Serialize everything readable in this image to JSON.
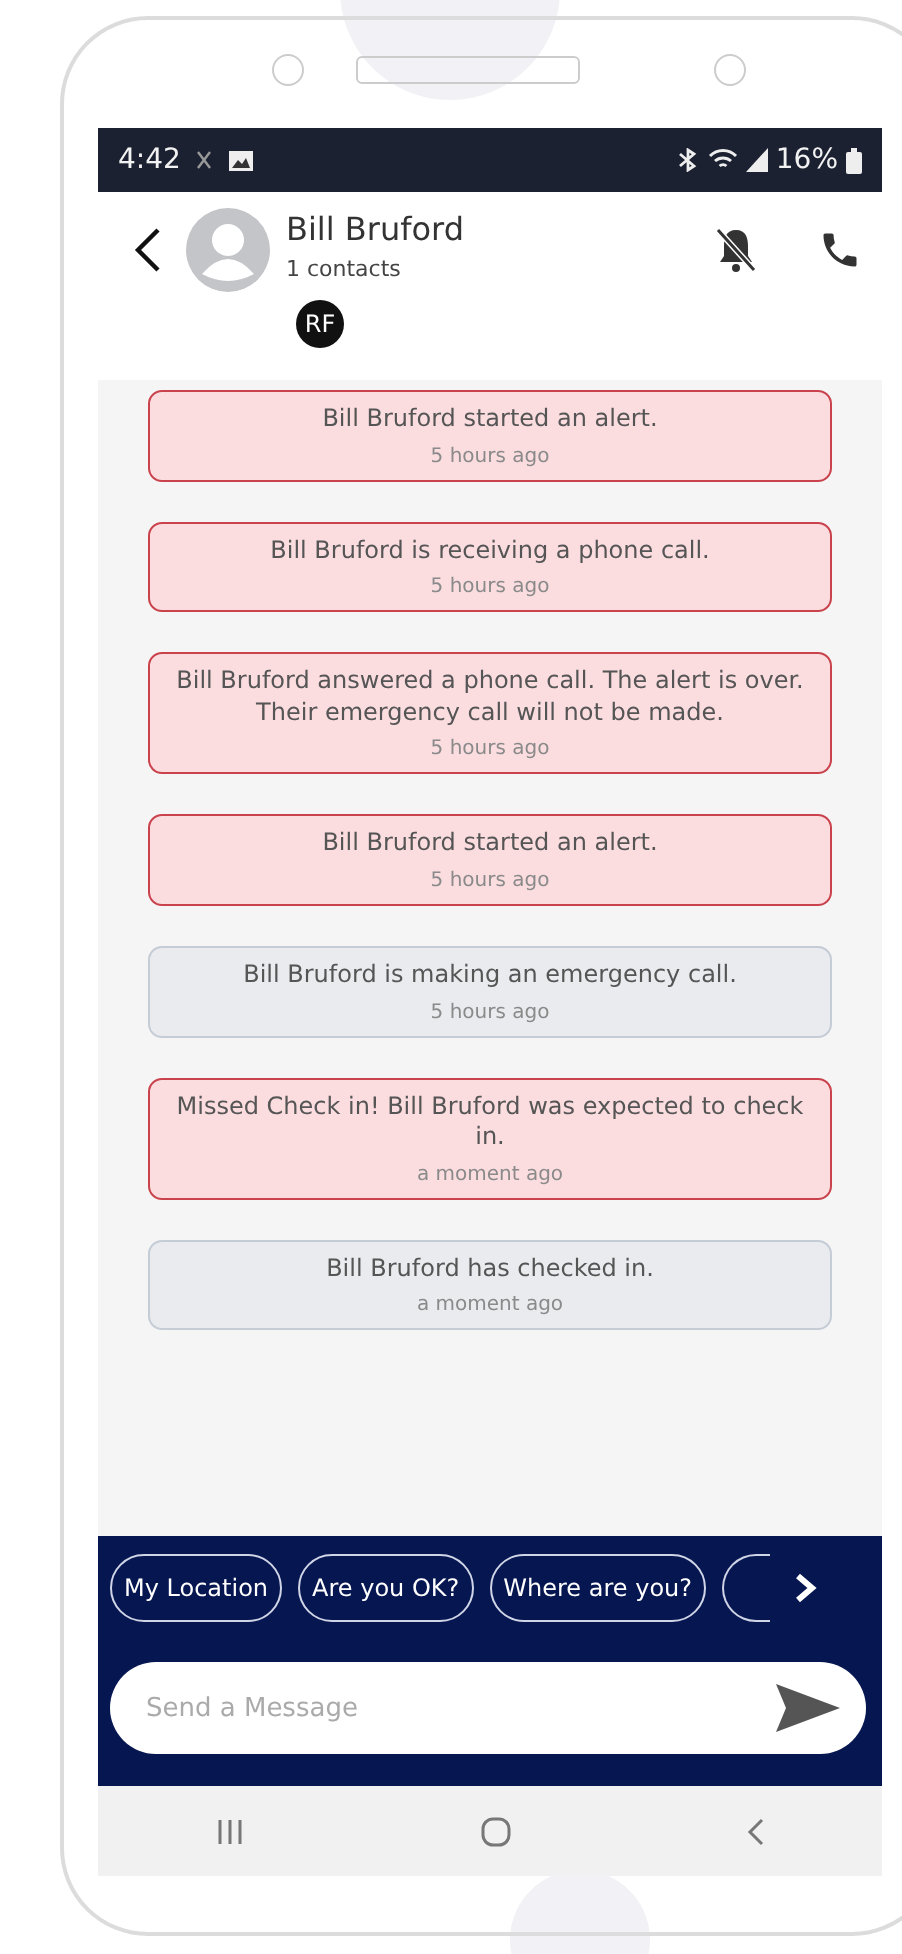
{
  "status_bar": {
    "time": "4:42",
    "battery": "16%"
  },
  "header": {
    "name": "Bill Bruford",
    "subtitle": "1 contacts",
    "badge": "RF"
  },
  "messages": [
    {
      "kind": "alert",
      "text": "Bill Bruford started an alert.",
      "time": "5 hours ago"
    },
    {
      "kind": "alert",
      "text": "Bill Bruford is receiving a phone call.",
      "time": "5 hours ago"
    },
    {
      "kind": "alert",
      "text": "Bill Bruford answered a phone call. The alert is over. Their emergency call will not be made.",
      "time": "5 hours ago"
    },
    {
      "kind": "alert",
      "text": "Bill Bruford started an alert.",
      "time": "5 hours ago"
    },
    {
      "kind": "info",
      "text": "Bill Bruford is making an emergency call.",
      "time": "5 hours ago"
    },
    {
      "kind": "alert",
      "text": "Missed Check in! Bill Bruford was expected to check in.",
      "time": "a moment ago"
    },
    {
      "kind": "info",
      "text": "Bill Bruford has checked in.",
      "time": "a moment ago"
    }
  ],
  "quick_replies": [
    "My Location",
    "Are you OK?",
    "Where are you?"
  ],
  "composer": {
    "placeholder": "Send a Message"
  }
}
